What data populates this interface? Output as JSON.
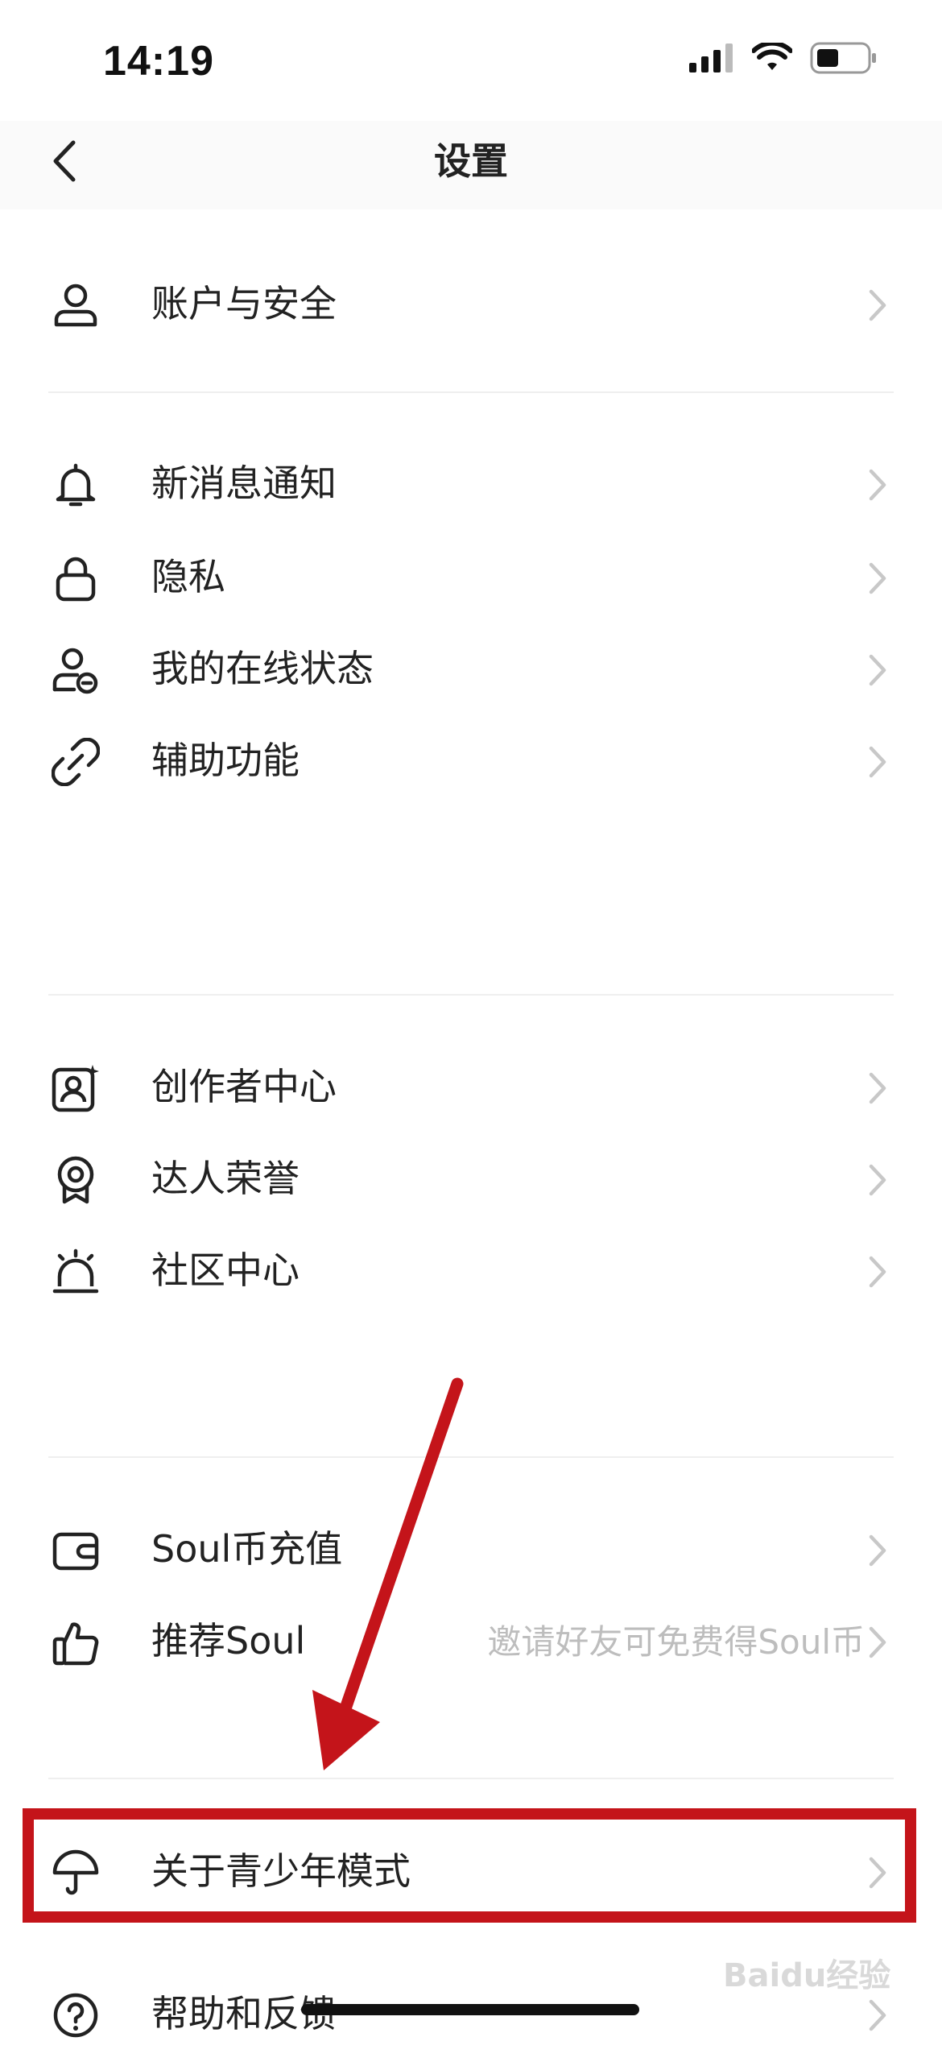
{
  "status_bar": {
    "time": "14:19"
  },
  "nav": {
    "title": "设置"
  },
  "items": [
    {
      "label": "账户与安全",
      "icon": "user-icon"
    },
    {
      "label": "新消息通知",
      "icon": "bell-icon"
    },
    {
      "label": "隐私",
      "icon": "lock-icon"
    },
    {
      "label": "我的在线状态",
      "icon": "user-status-icon"
    },
    {
      "label": "辅助功能",
      "icon": "link-icon"
    },
    {
      "label": "创作者中心",
      "icon": "creator-icon"
    },
    {
      "label": "达人荣誉",
      "icon": "badge-icon"
    },
    {
      "label": "社区中心",
      "icon": "alarm-icon"
    },
    {
      "label": "Soul币充值",
      "icon": "wallet-icon"
    },
    {
      "label": "推荐Soul",
      "icon": "thumbs-up-icon",
      "sublabel": "邀请好友可免费得Soul币"
    },
    {
      "label": "关于青少年模式",
      "icon": "umbrella-icon"
    },
    {
      "label": "帮助和反馈",
      "icon": "help-icon"
    }
  ],
  "watermark": "Baidu经验",
  "colors": {
    "highlight": "#c4141a",
    "arrow": "#c4141a",
    "chevron": "#c8c8c8",
    "subtext": "#bdbdbd"
  }
}
